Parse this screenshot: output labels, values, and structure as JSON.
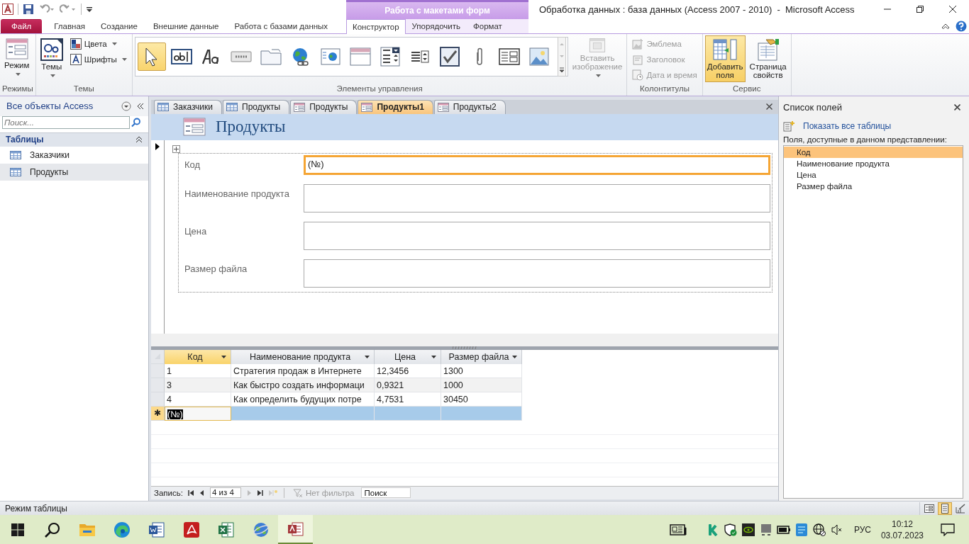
{
  "window": {
    "title": "Обработка данных : база данных (Access 2007 - 2010)  -  Microsoft Access",
    "context_group": "Работа с макетами форм"
  },
  "ribbon_tabs": [
    {
      "label": "Файл",
      "kind": "file",
      "context": false,
      "selected": false
    },
    {
      "label": "Главная",
      "kind": "tab",
      "context": false,
      "selected": false
    },
    {
      "label": "Создание",
      "kind": "tab",
      "context": false,
      "selected": false
    },
    {
      "label": "Внешние данные",
      "kind": "tab",
      "context": false,
      "selected": false
    },
    {
      "label": "Работа с базами данных",
      "kind": "tab",
      "context": false,
      "selected": false
    },
    {
      "label": "Конструктор",
      "kind": "tab",
      "context": true,
      "selected": true
    },
    {
      "label": "Упорядочить",
      "kind": "tab",
      "context": true,
      "selected": false
    },
    {
      "label": "Формат",
      "kind": "tab",
      "context": true,
      "selected": false
    }
  ],
  "ribbon_groups": [
    {
      "title": "Режимы",
      "commands": [
        {
          "label": "Режим",
          "kind": "view",
          "dropdown": true,
          "disabled": false,
          "pressed": false
        }
      ]
    },
    {
      "title": "Темы",
      "commands": [
        {
          "label": "Темы",
          "kind": "themes",
          "dropdown": true,
          "disabled": false,
          "pressed": false
        },
        {
          "label": "Цвета",
          "kind": "colors",
          "dropdown": true,
          "disabled": false,
          "pressed": false
        },
        {
          "label": "Шрифты",
          "kind": "fonts",
          "dropdown": true,
          "disabled": false,
          "pressed": false
        }
      ]
    },
    {
      "title": "Элементы управления",
      "gallery": [
        {
          "kind": "pointer",
          "selected": true
        },
        {
          "kind": "textbox",
          "selected": false
        },
        {
          "kind": "label",
          "selected": false
        },
        {
          "kind": "button",
          "selected": false
        },
        {
          "kind": "tab",
          "selected": false
        },
        {
          "kind": "hyperlink",
          "selected": false
        },
        {
          "kind": "web",
          "selected": false
        },
        {
          "kind": "navigation",
          "selected": false
        },
        {
          "kind": "combo",
          "selected": false
        },
        {
          "kind": "list",
          "selected": false
        },
        {
          "kind": "checkbox",
          "selected": false
        },
        {
          "kind": "attachment",
          "selected": false
        },
        {
          "kind": "subform",
          "selected": false
        },
        {
          "kind": "image",
          "selected": false
        }
      ],
      "commands": [
        {
          "label": "Вставить изображение",
          "kind": "insert-image",
          "dropdown": true,
          "disabled": true,
          "pressed": false
        }
      ]
    },
    {
      "title": "Колонтитулы",
      "commands": [
        {
          "label": "Эмблема",
          "kind": "logo",
          "dropdown": false,
          "disabled": true,
          "pressed": false
        },
        {
          "label": "Заголовок",
          "kind": "title",
          "dropdown": false,
          "disabled": true,
          "pressed": false
        },
        {
          "label": "Дата и время",
          "kind": "date-time",
          "dropdown": false,
          "disabled": true,
          "pressed": false
        }
      ]
    },
    {
      "title": "Сервис",
      "commands": [
        {
          "label": "Добавить поля",
          "kind": "add-fields",
          "dropdown": false,
          "disabled": false,
          "pressed": true
        },
        {
          "label": "Страница свойств",
          "kind": "property-sheet",
          "dropdown": false,
          "disabled": false,
          "pressed": false
        }
      ]
    }
  ],
  "nav_pane": {
    "title": "Все объекты Access",
    "search_placeholder": "Поиск...",
    "groups": [
      {
        "title": "Таблицы",
        "expanded": true,
        "items": [
          {
            "label": "Заказчики",
            "selected": false
          },
          {
            "label": "Продукты",
            "selected": true
          }
        ]
      }
    ]
  },
  "doc_tabs": [
    {
      "label": "Заказчики",
      "kind": "table",
      "selected": false
    },
    {
      "label": "Продукты",
      "kind": "table",
      "selected": false
    },
    {
      "label": "Продукты",
      "kind": "form",
      "selected": false
    },
    {
      "label": "Продукты1",
      "kind": "form",
      "selected": true
    },
    {
      "label": "Продукты2",
      "kind": "form",
      "selected": false
    }
  ],
  "form": {
    "title": "Продукты",
    "fields": [
      {
        "label": "Код",
        "value": "(№)",
        "selected": true
      },
      {
        "label": "Наименование продукта",
        "selected": false
      },
      {
        "label": "Цена",
        "selected": false
      },
      {
        "label": "Размер файла",
        "selected": false
      }
    ]
  },
  "datasheet": {
    "columns": [
      {
        "label": "Код",
        "selected": true
      },
      {
        "label": "Наименование продукта",
        "selected": false
      },
      {
        "label": "Цена",
        "selected": false
      },
      {
        "label": "Размер файла",
        "selected": false
      }
    ],
    "rows": [
      {
        "cells": [
          "1",
          "Стратегия продаж в Интернете",
          "12,3456",
          "1300"
        ],
        "selected": false
      },
      {
        "cells": [
          "3",
          "Как быстро создать информаци",
          "0,9321",
          "1000"
        ],
        "selected": false
      },
      {
        "cells": [
          "4",
          "Как определить будущих потре",
          "4,7531",
          "30450"
        ],
        "selected": false
      }
    ],
    "new_row": {
      "marker": "✱",
      "value": "(№)",
      "selected": true
    }
  },
  "record_nav": {
    "label": "Запись:",
    "position": "4 из 4",
    "filter": "Нет фильтра",
    "search_placeholder": "Поиск"
  },
  "field_list": {
    "title": "Список полей",
    "link": "Показать все таблицы",
    "caption": "Поля, доступные в данном представлении:",
    "fields": [
      {
        "label": "Код",
        "selected": true
      },
      {
        "label": "Наименование продукта",
        "selected": false
      },
      {
        "label": "Цена",
        "selected": false
      },
      {
        "label": "Размер файла",
        "selected": false
      }
    ]
  },
  "status_bar": {
    "text": "Режим таблицы",
    "views": [
      {
        "kind": "form",
        "selected": false
      },
      {
        "kind": "layout",
        "selected": true
      },
      {
        "kind": "design",
        "selected": false
      }
    ]
  },
  "taskbar": {
    "apps": [
      {
        "kind": "start",
        "active": false
      },
      {
        "kind": "search",
        "active": false
      },
      {
        "kind": "explorer",
        "active": false
      },
      {
        "kind": "edge",
        "active": false
      },
      {
        "kind": "word",
        "active": false
      },
      {
        "kind": "acrobat",
        "active": false
      },
      {
        "kind": "excel",
        "active": false
      },
      {
        "kind": "globe-app",
        "active": false
      },
      {
        "kind": "access",
        "active": true
      }
    ],
    "tray": [
      {
        "kind": "news"
      },
      {
        "kind": "antivirus"
      },
      {
        "kind": "shield"
      },
      {
        "kind": "gpu"
      },
      {
        "kind": "device"
      },
      {
        "kind": "battery"
      },
      {
        "kind": "app"
      },
      {
        "kind": "network"
      },
      {
        "kind": "volume-muted"
      }
    ],
    "language": "РУС",
    "time": "10:12",
    "date": "03.07.2023"
  }
}
